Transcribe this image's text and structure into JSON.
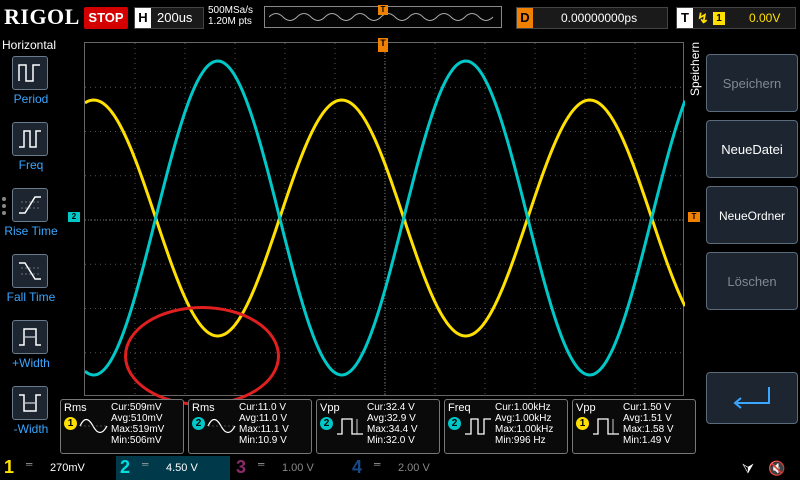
{
  "top": {
    "brand": "RIGOL",
    "run_state": "STOP",
    "horizontal": {
      "label": "H",
      "timebase": "200us"
    },
    "sample_rate": "500MSa/s",
    "mem_depth": "1.20M pts",
    "trigger_pos_marker": "T",
    "delay": {
      "label": "D",
      "value": "0.00000000ps"
    },
    "trigger": {
      "label": "T",
      "edge_icon": "rising-edge-icon",
      "source": "1",
      "level": "0.00V"
    }
  },
  "left_menu": {
    "title": "Horizontal",
    "items": [
      {
        "label": "Period",
        "icon": "period-icon"
      },
      {
        "label": "Freq",
        "icon": "frequency-icon"
      },
      {
        "label": "Rise Time",
        "icon": "rise-time-icon"
      },
      {
        "label": "Fall Time",
        "icon": "fall-time-icon"
      },
      {
        "label": "+Width",
        "icon": "positive-width-icon"
      },
      {
        "label": "-Width",
        "icon": "negative-width-icon"
      }
    ]
  },
  "markers": {
    "ch2": "2",
    "trigger": "T"
  },
  "right_menu": {
    "title": "Speichern",
    "buttons": [
      {
        "label": "Speichern",
        "enabled": false
      },
      {
        "label": "NeueDatei",
        "enabled": true
      },
      {
        "label": "NeueOrdner",
        "enabled": true
      },
      {
        "label": "Löschen",
        "enabled": false
      }
    ],
    "enter_icon": "enter-icon"
  },
  "measurements": [
    {
      "name": "Rms",
      "ch": "1",
      "color": "#ffe000",
      "icon": "rms-icon",
      "cur": "Cur:509mV",
      "avg": "Avg:510mV",
      "max": "Max:519mV",
      "min": "Min:506mV"
    },
    {
      "name": "Rms",
      "ch": "2",
      "color": "#00c8c8",
      "icon": "rms-icon",
      "cur": "Cur:11.0 V",
      "avg": "Avg:11.0 V",
      "max": "Max:11.1 V",
      "min": "Min:10.9 V"
    },
    {
      "name": "Vpp",
      "ch": "2",
      "color": "#00c8c8",
      "icon": "vpp-icon",
      "cur": "Cur:32.4 V",
      "avg": "Avg:32.9 V",
      "max": "Max:34.4 V",
      "min": "Min:32.0 V"
    },
    {
      "name": "Freq",
      "ch": "2",
      "color": "#00c8c8",
      "icon": "frequency-icon",
      "cur": "Cur:1.00kHz",
      "avg": "Avg:1.00kHz",
      "max": "Max:1.00kHz",
      "min": "Min:996 Hz"
    },
    {
      "name": "Vpp",
      "ch": "1",
      "color": "#ffe000",
      "icon": "vpp-icon",
      "cur": "Cur:1.50 V",
      "avg": "Avg:1.51 V",
      "max": "Max:1.58 V",
      "min": "Min:1.49 V"
    }
  ],
  "channels": [
    {
      "num": "1",
      "coupling": "═",
      "scale": "270mV",
      "active": true
    },
    {
      "num": "2",
      "coupling": "═",
      "scale": "4.50 V",
      "active": true
    },
    {
      "num": "3",
      "coupling": "═",
      "scale": "1.00 V",
      "active": false
    },
    {
      "num": "4",
      "coupling": "═",
      "scale": "2.00 V",
      "active": false
    }
  ],
  "status_icons": {
    "usb": "usb-icon",
    "speaker": "speaker-muted-icon"
  },
  "colors": {
    "ch1": "#ffe000",
    "ch2": "#00c8c8",
    "trigger": "#f08000",
    "stop": "#d40000",
    "highlight": "#e02020"
  }
}
